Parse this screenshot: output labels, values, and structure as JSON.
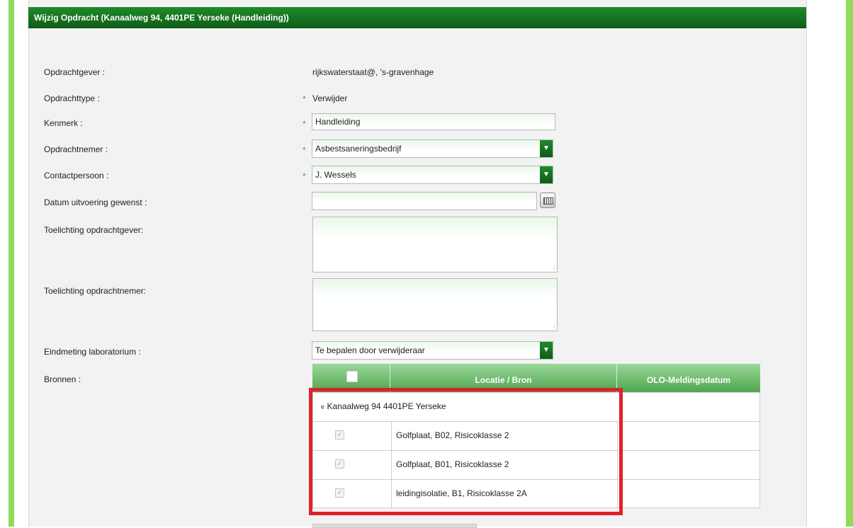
{
  "page": {
    "title": "Wijzig Opdracht (Kanaalweg 94, 4401PE Yerseke (Handleiding))"
  },
  "form": {
    "opdrachtgever": {
      "label": "Opdrachtgever :",
      "value": "rijkswaterstaat@, 's-gravenhage"
    },
    "opdrachttype": {
      "label": "Opdrachttype :",
      "value": "Verwijder",
      "required": true
    },
    "kenmerk": {
      "label": "Kenmerk :",
      "value": "Handleiding",
      "required": true
    },
    "opdrachtnemer": {
      "label": "Opdrachtnemer :",
      "value": "Asbestsaneringsbedrijf",
      "required": true
    },
    "contactpersoon": {
      "label": "Contactpersoon :",
      "value": "J. Wessels",
      "required": true
    },
    "datum": {
      "label": "Datum uitvoering gewenst :",
      "value": ""
    },
    "toelichting_gever": {
      "label": "Toelichting opdrachtgever:",
      "value": ""
    },
    "toelichting_nemer": {
      "label": "Toelichting opdrachtnemer:",
      "value": ""
    },
    "eindmeting": {
      "label": "Eindmeting laboratorium :",
      "value": "Te bepalen door verwijderaar"
    },
    "bronnen": {
      "label": "Bronnen :"
    },
    "required_mark": "*"
  },
  "sources_table": {
    "headers": {
      "location": "Locatie / Bron",
      "olo": "OLO-Meldingsdatum"
    },
    "group": {
      "expand_icon": "double-chevron-down-icon",
      "label": "Kanaalweg 94 4401PE Yerseke"
    },
    "rows": [
      {
        "label": "Golfplaat, B02, Risicoklasse 2",
        "checked": true,
        "olo_date": ""
      },
      {
        "label": "Golfplaat, B01, Risicoklasse 2",
        "checked": true,
        "olo_date": ""
      },
      {
        "label": "leidingisolatie, B1, Risicoklasse 2A",
        "checked": true,
        "olo_date": ""
      }
    ]
  },
  "icons": {
    "dropdown": "triangle-down-icon",
    "calendar": "calendar-icon",
    "checkbox_mark": "✓",
    "group_toggle": "»"
  },
  "colors": {
    "header_green": "#0e5c16",
    "side_bar": "#8fdc5a",
    "table_header": "#4ea64e",
    "highlight_red": "#e0212b"
  }
}
